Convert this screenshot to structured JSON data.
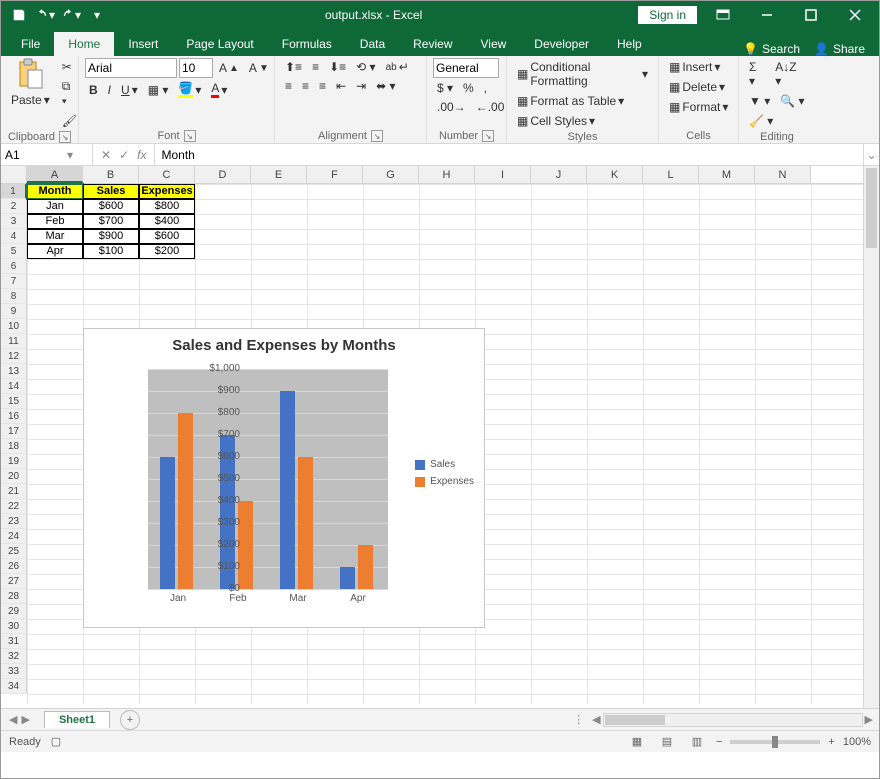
{
  "titlebar": {
    "filename": "output.xlsx - Excel",
    "signin": "Sign in"
  },
  "tabs": {
    "items": [
      "File",
      "Home",
      "Insert",
      "Page Layout",
      "Formulas",
      "Data",
      "Review",
      "View",
      "Developer",
      "Help"
    ],
    "active": "Home",
    "search": "Search",
    "share": "Share"
  },
  "ribbon": {
    "clipboard": {
      "paste": "Paste",
      "label": "Clipboard"
    },
    "font": {
      "name": "Arial",
      "size": "10",
      "label": "Font"
    },
    "alignment": {
      "label": "Alignment"
    },
    "number": {
      "format": "General",
      "label": "Number"
    },
    "styles": {
      "cond": "Conditional Formatting",
      "table": "Format as Table",
      "cell": "Cell Styles",
      "label": "Styles"
    },
    "cells": {
      "insert": "Insert",
      "delete": "Delete",
      "format": "Format",
      "label": "Cells"
    },
    "editing": {
      "label": "Editing"
    }
  },
  "namebox": {
    "ref": "A1",
    "formula": "Month"
  },
  "table": {
    "headers": [
      "Month",
      "Sales",
      "Expenses"
    ],
    "rows": [
      [
        "Jan",
        "$600",
        "$800"
      ],
      [
        "Feb",
        "$700",
        "$400"
      ],
      [
        "Mar",
        "$900",
        "$600"
      ],
      [
        "Apr",
        "$100",
        "$200"
      ]
    ]
  },
  "chart_data": {
    "type": "bar",
    "title": "Sales and Expenses by Months",
    "categories": [
      "Jan",
      "Feb",
      "Mar",
      "Apr"
    ],
    "series": [
      {
        "name": "Sales",
        "values": [
          600,
          700,
          900,
          100
        ],
        "color": "#4472c4"
      },
      {
        "name": "Expenses",
        "values": [
          800,
          400,
          600,
          200
        ],
        "color": "#ed7d31"
      }
    ],
    "ylim": [
      0,
      1000
    ],
    "ystep": 100,
    "yformat": "$"
  },
  "columns": [
    "A",
    "B",
    "C",
    "D",
    "E",
    "F",
    "G",
    "H",
    "I",
    "J",
    "K",
    "L",
    "M",
    "N"
  ],
  "sheet": {
    "name": "Sheet1"
  },
  "status": {
    "ready": "Ready",
    "zoom": "100%"
  }
}
